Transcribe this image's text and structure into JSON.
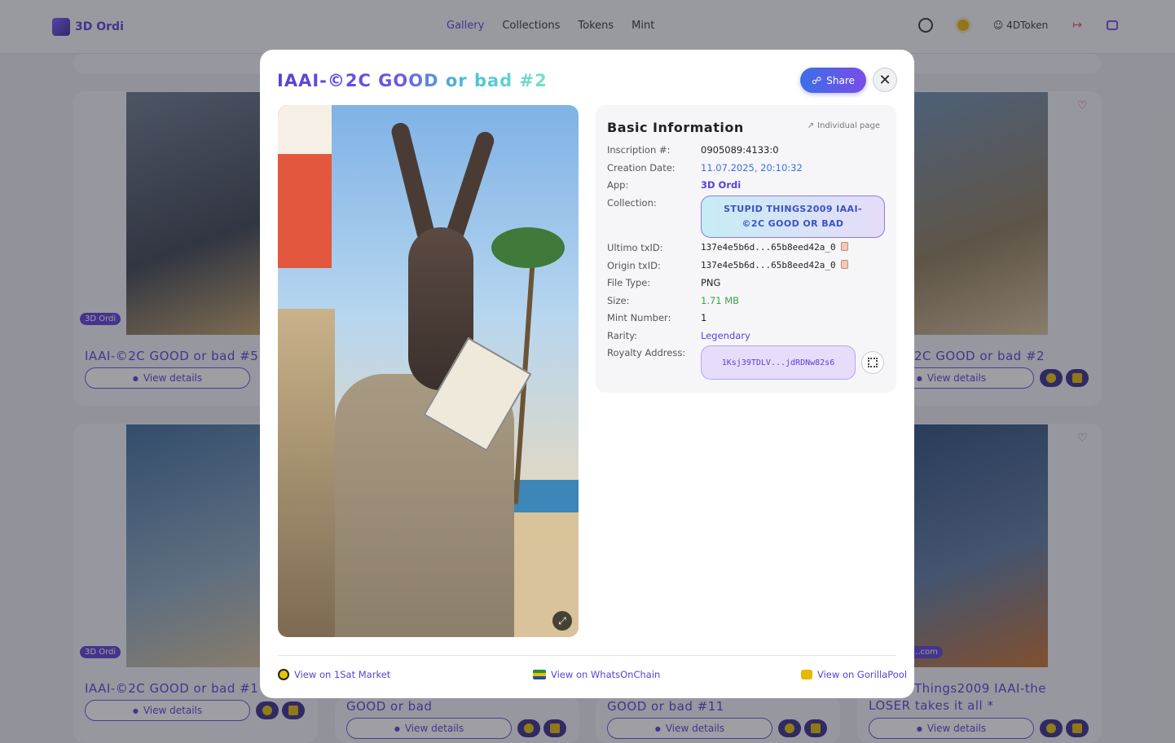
{
  "nav": {
    "brand": "3D Ordi",
    "links": [
      "Gallery",
      "Collections",
      "Tokens",
      "Mint"
    ],
    "active": "Gallery",
    "user": "4DToken",
    "icons": [
      "globe-icon",
      "sun-icon",
      "user-icon",
      "logout-icon",
      "wallet-icon"
    ]
  },
  "background": {
    "cards": [
      {
        "title": "IAAI-©2C GOOD or bad #5",
        "badge": "3D Ordi",
        "button": "View details"
      },
      {
        "title": "2C GOOD or bad #2",
        "button": "View details"
      },
      {
        "title": "IAAI-©2C GOOD or bad #1",
        "badge": "3D Ordi",
        "button": "View details"
      },
      {
        "title": "GOOD or bad",
        "button": "View details"
      },
      {
        "title": "GOOD or bad #11",
        "button": "View details"
      },
      {
        "title": "Things2009 IAAI-the",
        "title2": "LOSER takes it all *",
        "badge": "...com",
        "button": "View details"
      }
    ]
  },
  "modal": {
    "title": "IAAI-©2C GOOD or bad #2",
    "share_label": "Share",
    "info": {
      "heading": "Basic Information",
      "individual_page": "Individual page",
      "rows": {
        "inscription": {
          "label": "Inscription #:",
          "value": "0905089:4133:0"
        },
        "creation": {
          "label": "Creation Date:",
          "value": "11.07.2025, 20:10:32"
        },
        "app": {
          "label": "App:",
          "value": "3D Ordi"
        },
        "collection": {
          "label": "Collection:",
          "value": "STUPID THINGS2009 IAAI-©2C GOOD OR BAD"
        },
        "ultimo": {
          "label": "Ultimo txID:",
          "value": "137e4e5b6d...65b8eed42a_0"
        },
        "origin": {
          "label": "Origin txID:",
          "value": "137e4e5b6d...65b8eed42a_0"
        },
        "filetype": {
          "label": "File Type:",
          "value": "PNG"
        },
        "size": {
          "label": "Size:",
          "value": "1.71 MB"
        },
        "mint": {
          "label": "Mint Number:",
          "value": "1"
        },
        "rarity": {
          "label": "Rarity:",
          "value": "Legendary"
        },
        "royalty": {
          "label": "Royalty Address:",
          "value": "1Ksj39TDLV...jdRDNw82s6"
        }
      }
    },
    "links": {
      "market": "View on 1Sat Market",
      "woc": "View on WhatsOnChain",
      "gorilla": "View on GorillaPool"
    }
  }
}
